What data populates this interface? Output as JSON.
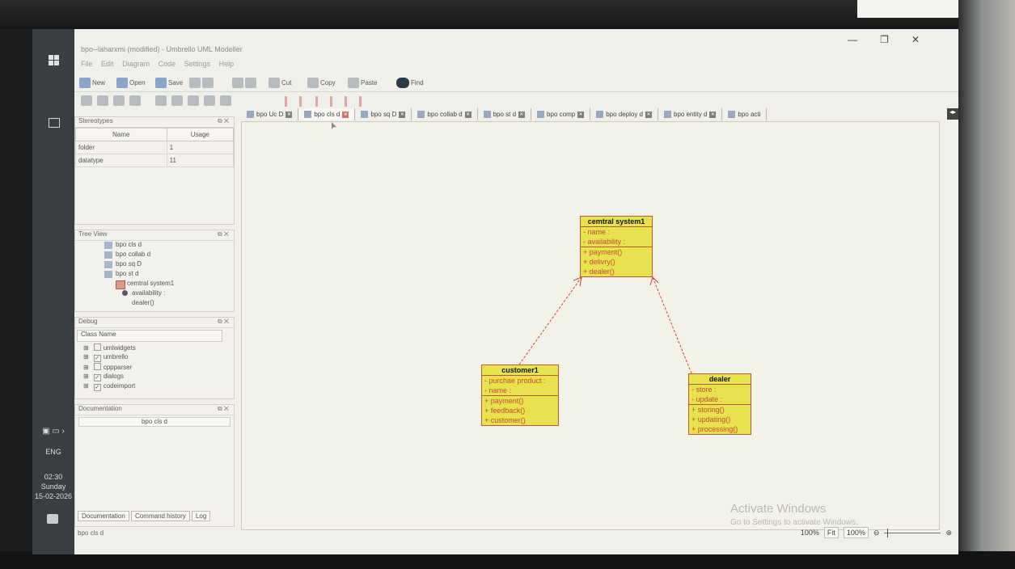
{
  "window": {
    "title": "bpo--laharxmi (modified) - Umbrello UML Modeller",
    "controls": [
      "—",
      "❐",
      "✕"
    ]
  },
  "taskbar": {
    "language": "ENG",
    "time": "02:30",
    "day": "Sunday",
    "date": "15-02-2026"
  },
  "menu": [
    "File",
    "Edit",
    "Diagram",
    "Code",
    "Settings",
    "Help"
  ],
  "toolbar": {
    "new": "New",
    "open": "Open",
    "save": "Save",
    "cut": "Cut",
    "copy": "Copy",
    "paste": "Paste",
    "find": "Find"
  },
  "stereotypes": {
    "title": "Stereotypes",
    "columns": [
      "Name",
      "Usage"
    ],
    "rows": [
      {
        "name": "folder",
        "usage": "1"
      },
      {
        "name": "datatype",
        "usage": "11"
      }
    ]
  },
  "tree_view": {
    "title": "Tree View",
    "items": [
      "bpo cls d",
      "bpo collab d",
      "bpo sq D",
      "bpo st d",
      "cemtral system1",
      "availability :",
      "dealer()"
    ]
  },
  "debug": {
    "title": "Debug",
    "header": "Class Name",
    "items": [
      {
        "label": "umlwidgets",
        "checked": false
      },
      {
        "label": "umbrello",
        "checked": true
      },
      {
        "label": "cppparser",
        "checked": false
      },
      {
        "label": "dialogs",
        "checked": true
      },
      {
        "label": "codeimport",
        "checked": true
      }
    ]
  },
  "documentation": {
    "title": "Documentation",
    "field": "bpo cls d"
  },
  "bottom_tabs": [
    "Documentation",
    "Command history",
    "Log"
  ],
  "status": {
    "left": "bpo cls d",
    "zoom": "100%",
    "fit": "Fit",
    "zoom_box": "100%"
  },
  "diagram_tabs": [
    {
      "label": "bpo Uc D",
      "active": false
    },
    {
      "label": "bpo cls d",
      "active": true
    },
    {
      "label": "bpo sq D",
      "active": false
    },
    {
      "label": "bpo collab d",
      "active": false
    },
    {
      "label": "bpo st d",
      "active": false
    },
    {
      "label": "bpo comp",
      "active": false
    },
    {
      "label": "bpo deploy d",
      "active": false
    },
    {
      "label": "bpo entity d",
      "active": false
    },
    {
      "label": "bpo acti",
      "active": false
    }
  ],
  "classes": {
    "central": {
      "name": "cemtral system1",
      "attributes": [
        "- name :",
        "- availability :"
      ],
      "operations": [
        "+ payment()",
        "+ delivry()",
        "+ dealer()"
      ]
    },
    "customer": {
      "name": "customer1",
      "attributes": [
        "- purchae product :",
        "- name :"
      ],
      "operations": [
        "+ payment()",
        "+ feedback()",
        "+ customer()"
      ]
    },
    "dealer": {
      "name": "dealer",
      "attributes": [
        "- store :",
        "- update :"
      ],
      "operations": [
        "+ storing()",
        "+ updating()",
        "+ processing()"
      ]
    }
  },
  "watermark": {
    "line1": "Activate Windows",
    "line2": "Go to Settings to activate Windows."
  },
  "colors": {
    "class_fill": "#e7e24e",
    "class_border": "#b55a3a",
    "relation": "#d0452e"
  }
}
